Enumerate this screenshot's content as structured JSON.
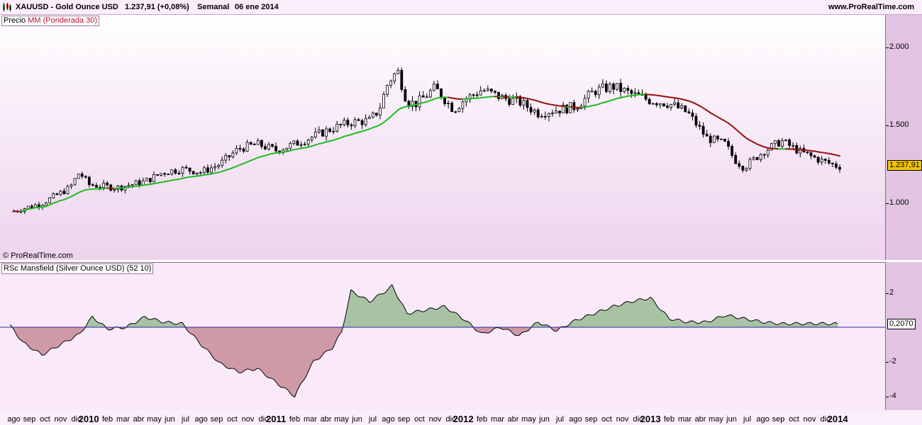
{
  "header": {
    "symbol": "XAUUSD - Gold Ounce USD",
    "price_change": "1.237,91 (+0,08%)",
    "period": "Semanal",
    "date": "06 ene 2014",
    "site": "www.ProRealTime.com"
  },
  "price_panel": {
    "label_price": "Precio",
    "label_ma": "MM (Ponderada 30)",
    "copyright": "© ProRealTime.com",
    "y_ticks": [
      "2.000",
      "1.500",
      "1.000"
    ],
    "last_value": "1.237,91"
  },
  "rsc_panel": {
    "label": "RSc Mansfield (Silver Ounce USD) (52 10)",
    "y_ticks": [
      "2",
      "-2",
      "-4"
    ],
    "last_value": "0,2070"
  },
  "x_axis": {
    "labels": [
      "ago",
      "sep",
      "oct",
      "nov",
      "dic",
      "2010",
      "feb",
      "mar",
      "abr",
      "may",
      "jun",
      "jul",
      "ago",
      "sep",
      "oct",
      "nov",
      "dic",
      "2011",
      "feb",
      "mar",
      "abr",
      "may",
      "jun",
      "jul",
      "ago",
      "sep",
      "oct",
      "nov",
      "dic",
      "2012",
      "feb",
      "mar",
      "abr",
      "may",
      "jun",
      "jul",
      "ago",
      "sep",
      "oct",
      "nov",
      "dic",
      "2013",
      "feb",
      "mar",
      "abr",
      "may",
      "jun",
      "jul",
      "ago",
      "sep",
      "oct",
      "nov",
      "dic",
      "2014"
    ]
  },
  "colors": {
    "ma_rising": "#22bb22",
    "ma_falling": "#991111",
    "rsc_positive": "#a7c3a4",
    "rsc_negative": "#cf9aa6",
    "baseline": "#2a2aa0",
    "last_box": "#f2c300"
  },
  "chart_data": [
    {
      "type": "candlestick",
      "title": "XAUUSD - Gold Ounce USD",
      "x_range": [
        "2009-08",
        "2014-01"
      ],
      "ylim": [
        700,
        2250
      ],
      "series": [
        {
          "name": "Precio",
          "description_values": [
            [
              2009.6,
              950
            ],
            [
              2009.75,
              1000
            ],
            [
              2009.9,
              1100
            ],
            [
              2009.95,
              1200
            ],
            [
              2010.0,
              1120
            ],
            [
              2010.15,
              1100
            ],
            [
              2010.3,
              1140
            ],
            [
              2010.4,
              1200
            ],
            [
              2010.5,
              1220
            ],
            [
              2010.6,
              1200
            ],
            [
              2010.7,
              1250
            ],
            [
              2010.8,
              1350
            ],
            [
              2010.9,
              1380
            ],
            [
              2011.0,
              1340
            ],
            [
              2011.1,
              1380
            ],
            [
              2011.2,
              1430
            ],
            [
              2011.3,
              1480
            ],
            [
              2011.4,
              1520
            ],
            [
              2011.5,
              1530
            ],
            [
              2011.55,
              1600
            ],
            [
              2011.6,
              1780
            ],
            [
              2011.65,
              1850
            ],
            [
              2011.7,
              1650
            ],
            [
              2011.75,
              1640
            ],
            [
              2011.85,
              1740
            ],
            [
              2011.95,
              1600
            ],
            [
              2012.0,
              1660
            ],
            [
              2012.1,
              1730
            ],
            [
              2012.2,
              1680
            ],
            [
              2012.3,
              1650
            ],
            [
              2012.4,
              1580
            ],
            [
              2012.5,
              1600
            ],
            [
              2012.6,
              1620
            ],
            [
              2012.7,
              1720
            ],
            [
              2012.8,
              1750
            ],
            [
              2012.9,
              1700
            ],
            [
              2013.0,
              1660
            ],
            [
              2013.1,
              1640
            ],
            [
              2013.2,
              1580
            ],
            [
              2013.3,
              1420
            ],
            [
              2013.4,
              1380
            ],
            [
              2013.45,
              1280
            ],
            [
              2013.5,
              1230
            ],
            [
              2013.6,
              1330
            ],
            [
              2013.7,
              1400
            ],
            [
              2013.8,
              1330
            ],
            [
              2013.9,
              1280
            ],
            [
              2014.0,
              1237.91
            ]
          ]
        },
        {
          "name": "MM (Ponderada 30)"
        }
      ],
      "last": 1237.91
    },
    {
      "type": "area",
      "title": "RSc Mansfield (Silver Ounce USD) (52 10)",
      "ylim": [
        -4.8,
        3.2
      ],
      "x": [
        2009.58,
        2009.65,
        2009.75,
        2009.85,
        2009.95,
        2010.02,
        2010.1,
        2010.2,
        2010.3,
        2010.4,
        2010.5,
        2010.6,
        2010.7,
        2010.8,
        2010.9,
        2011.0,
        2011.1,
        2011.2,
        2011.3,
        2011.35,
        2011.4,
        2011.5,
        2011.6,
        2011.62,
        2011.7,
        2011.8,
        2011.9,
        2012.0,
        2012.1,
        2012.2,
        2012.3,
        2012.4,
        2012.5,
        2012.6,
        2012.7,
        2012.8,
        2012.9,
        2013.0,
        2013.1,
        2013.2,
        2013.3,
        2013.4,
        2013.5,
        2013.6,
        2013.7,
        2013.8,
        2013.9,
        2014.0
      ],
      "values": [
        0.1,
        -0.9,
        -1.6,
        -1.0,
        -0.4,
        0.6,
        -0.1,
        0.0,
        0.6,
        0.3,
        0.2,
        -1.0,
        -2.1,
        -2.6,
        -2.4,
        -3.2,
        -4.0,
        -2.0,
        -1.2,
        -0.3,
        2.1,
        1.5,
        2.2,
        2.4,
        0.8,
        1.0,
        1.2,
        0.5,
        -0.4,
        0.0,
        -0.5,
        0.3,
        -0.2,
        0.4,
        0.8,
        1.2,
        1.5,
        1.7,
        0.5,
        0.3,
        0.3,
        0.7,
        0.5,
        0.3,
        0.2,
        0.21,
        0.21,
        0.207
      ],
      "baseline": 0,
      "last": 0.207
    }
  ]
}
